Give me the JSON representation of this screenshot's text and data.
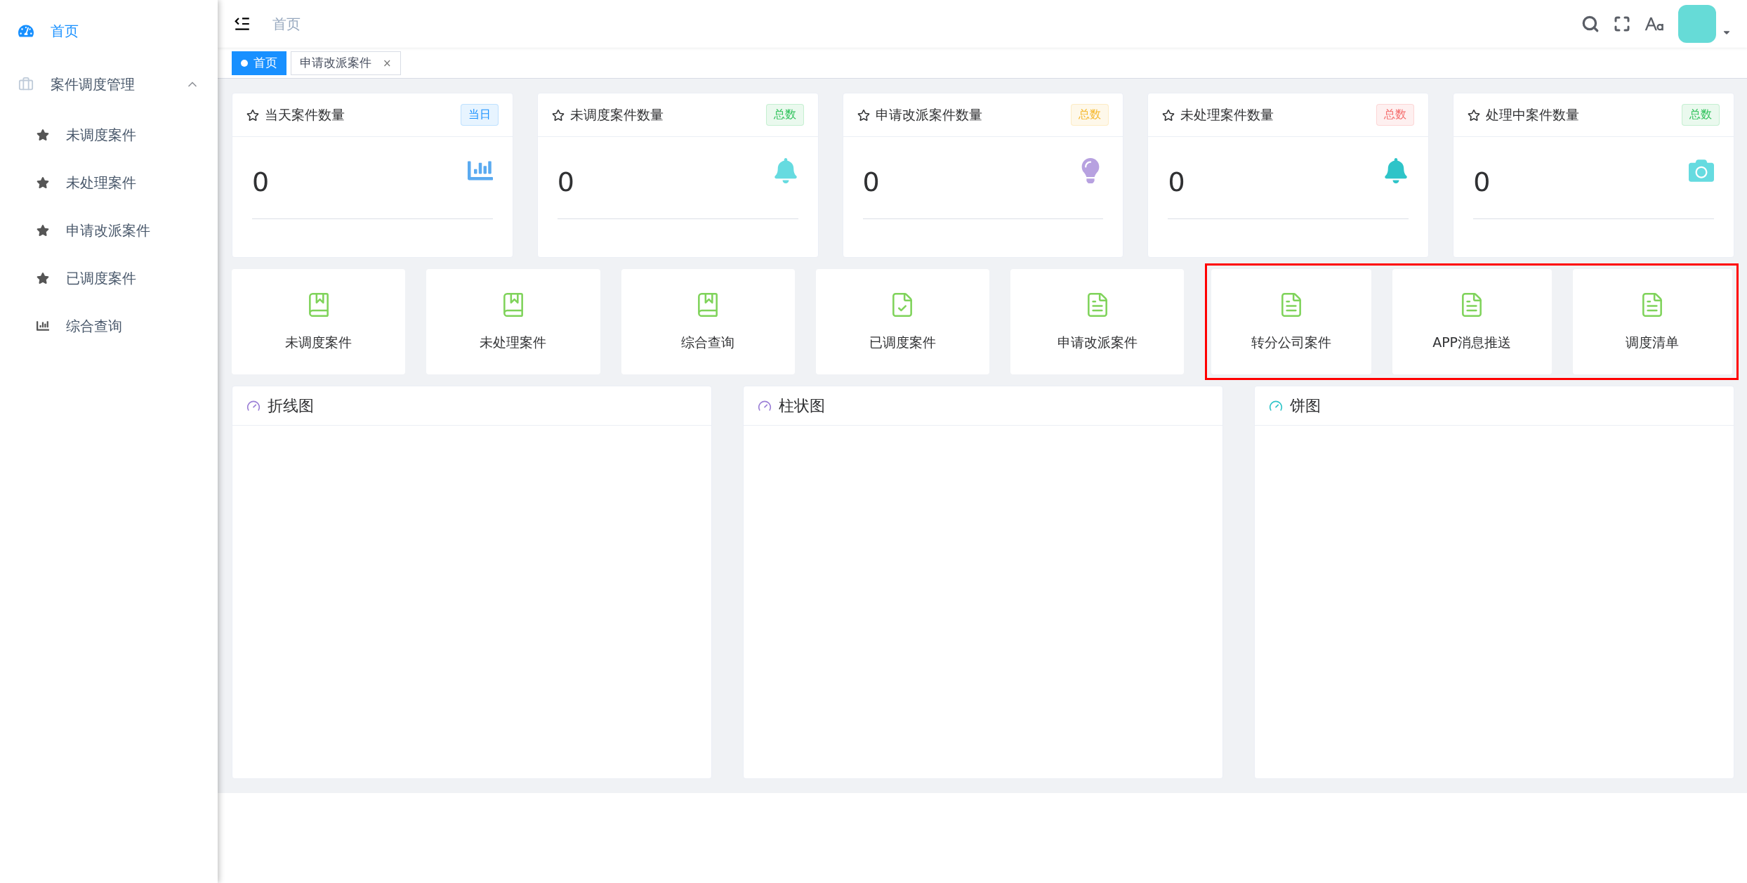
{
  "sidebar": {
    "items": [
      {
        "label": "首页",
        "kind": "dashboard",
        "selected": true
      },
      {
        "label": "案件调度管理",
        "kind": "briefcase",
        "selected": false,
        "expanded": true,
        "children": [
          {
            "label": "未调度案件",
            "kind": "star",
            "selected": false
          },
          {
            "label": "未处理案件",
            "kind": "star",
            "selected": false
          },
          {
            "label": "申请改派案件",
            "kind": "star",
            "selected": false
          },
          {
            "label": "已调度案件",
            "kind": "star",
            "selected": false
          },
          {
            "label": "综合查询",
            "kind": "bars",
            "selected": false
          }
        ]
      }
    ]
  },
  "header": {
    "breadcrumb": "首页"
  },
  "tabs": [
    {
      "label": "首页",
      "selected": true,
      "closable": false
    },
    {
      "label": "申请改派案件",
      "selected": false,
      "closable": true,
      "close": "×"
    }
  ],
  "stat_cards": [
    {
      "title": "当天案件数量",
      "tag": "当日",
      "color": "#1890ff",
      "value": "0",
      "kind": "bars"
    },
    {
      "title": "未调度案件数量",
      "tag": "总数",
      "color": "#2fc25b",
      "value": "0",
      "kind": "bell"
    },
    {
      "title": "申请改派案件数量",
      "tag": "总数",
      "color": "#f5b82e",
      "value": "0",
      "kind": "bulb"
    },
    {
      "title": "未处理案件数量",
      "tag": "总数",
      "color": "#f56c6c",
      "value": "0",
      "kind": "bell"
    },
    {
      "title": "处理中案件数量",
      "tag": "总数",
      "color": "#2fc25b",
      "value": "0",
      "kind": "camera"
    }
  ],
  "shortcuts": [
    {
      "label": "未调度案件",
      "kind": "book",
      "highlighted": false
    },
    {
      "label": "未处理案件",
      "kind": "book",
      "highlighted": false
    },
    {
      "label": "综合查询",
      "kind": "book",
      "highlighted": false
    },
    {
      "label": "已调度案件",
      "kind": "check",
      "highlighted": false
    },
    {
      "label": "申请改派案件",
      "kind": "file",
      "highlighted": false
    },
    {
      "label": "转分公司案件",
      "kind": "file",
      "highlighted": true
    },
    {
      "label": "APP消息推送",
      "kind": "file",
      "highlighted": true
    },
    {
      "label": "调度清单",
      "kind": "file",
      "highlighted": true
    }
  ],
  "chart_panels": [
    {
      "title": "折线图"
    },
    {
      "title": "柱状图"
    },
    {
      "title": "饼图"
    }
  ]
}
